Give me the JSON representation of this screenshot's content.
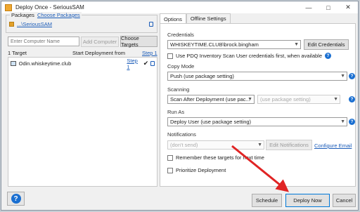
{
  "window": {
    "title": "Deploy Once - SeriousSAM"
  },
  "packages": {
    "legend": "Packages",
    "choose_link": "Choose Packages",
    "package_name": "...\\SeriousSAM"
  },
  "targets": {
    "input_placeholder": "Enter Computer Name",
    "add_button": "Add Computer",
    "choose_button": "Choose Targets",
    "count": "1 Target",
    "start_from_label": "Start Deployment from",
    "step_link": "Step 1",
    "rows": [
      {
        "name": "Odin.whiskeytime.club",
        "step": "Step 1"
      }
    ]
  },
  "tabs": [
    {
      "label": "Options"
    },
    {
      "label": "Offline Settings"
    }
  ],
  "options": {
    "credentials_label": "Credentials",
    "credentials_value": "WHISKEYTIME.CLUB\\brock.bingham",
    "edit_credentials": "Edit Credentials",
    "use_scan_creds": "Use PDQ Inventory Scan User credentials first, when available",
    "copy_mode_label": "Copy Mode",
    "copy_mode_value": "Push (use package setting)",
    "scanning_label": "Scanning",
    "scanning_value": "Scan After Deployment (use pac...",
    "scanning_secondary": "(use package setting)",
    "run_as_label": "Run As",
    "run_as_value": "Deploy User (use package setting)",
    "notifications_label": "Notifications",
    "notifications_value": "(don't send)",
    "edit_notifications": "Edit Notifications",
    "configure_email": "Configure Email",
    "remember_targets": "Remember these targets for next time",
    "prioritize": "Prioritize Deployment"
  },
  "footer": {
    "help_glyph": "?",
    "schedule": "Schedule",
    "deploy_now": "Deploy Now",
    "cancel": "Cancel"
  },
  "colors": {
    "link": "#1a5bb8",
    "annotation_arrow": "#e02424",
    "help": "#1a6fd1"
  }
}
